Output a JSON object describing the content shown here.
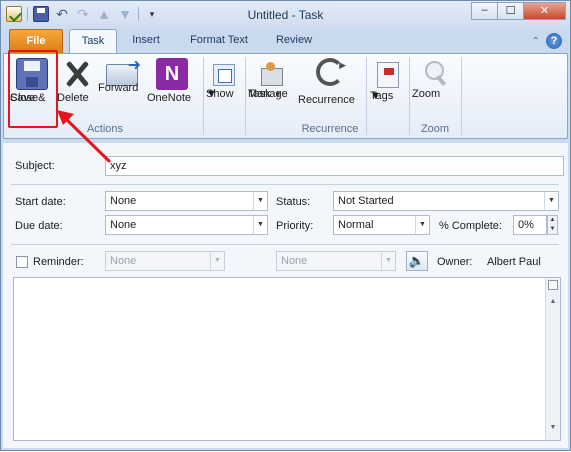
{
  "window": {
    "title": "Untitled  -  Task",
    "minimize": "–",
    "maximize": "☐",
    "close": "✕"
  },
  "tabs": {
    "file": "File",
    "task": "Task",
    "insert": "Insert",
    "format_text": "Format Text",
    "review": "Review"
  },
  "ribbon": {
    "save_close_1": "Save &",
    "save_close_2": "Close",
    "delete": "Delete",
    "forward": "Forward",
    "onenote": "OneNote",
    "onenote_glyph": "N",
    "show": "Show",
    "manage_task_1": "Manage",
    "manage_task_2": "Task",
    "recurrence": "Recurrence",
    "tags": "Tags",
    "zoom": "Zoom",
    "groups": {
      "actions": "Actions",
      "recurrence": "Recurrence",
      "zoom": "Zoom"
    }
  },
  "form": {
    "subject_label": "Subject:",
    "subject_value": "xyz",
    "start_date_label": "Start date:",
    "start_date_value": "None",
    "due_date_label": "Due date:",
    "due_date_value": "None",
    "status_label": "Status:",
    "status_value": "Not Started",
    "priority_label": "Priority:",
    "priority_value": "Normal",
    "complete_label": "% Complete:",
    "complete_value": "0%",
    "reminder_label": "Reminder:",
    "reminder_date": "None",
    "reminder_time": "None",
    "owner_label": "Owner:",
    "owner_value": "Albert Paul"
  },
  "colors": {
    "highlight": "#e8141d",
    "file_tab": "#e07b15"
  }
}
